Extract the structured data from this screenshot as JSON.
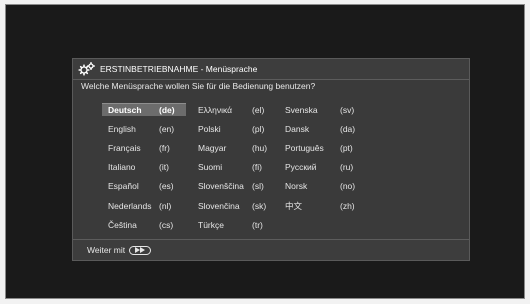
{
  "dialog": {
    "title": "ERSTINBETRIEBNAHME - Menüsprache",
    "icon": "gears-icon",
    "question": "Welche Menüsprache wollen Sie für die Bedienung benutzen?",
    "footer_label": "Weiter mit",
    "footer_icon": "fast-forward-button-icon"
  },
  "languages": [
    {
      "name": "Deutsch",
      "code": "(de)",
      "selected": true
    },
    {
      "name": "English",
      "code": "(en)"
    },
    {
      "name": "Français",
      "code": "(fr)"
    },
    {
      "name": "Italiano",
      "code": "(it)"
    },
    {
      "name": "Español",
      "code": "(es)"
    },
    {
      "name": "Nederlands",
      "code": "(nl)"
    },
    {
      "name": "Čeština",
      "code": "(cs)"
    },
    {
      "name": "Ελληνικά",
      "code": "(el)"
    },
    {
      "name": "Polski",
      "code": "(pl)"
    },
    {
      "name": "Magyar",
      "code": "(hu)"
    },
    {
      "name": "Suomi",
      "code": "(fi)"
    },
    {
      "name": "Slovenščina",
      "code": "(sl)"
    },
    {
      "name": "Slovenčina",
      "code": "(sk)"
    },
    {
      "name": "Türkçe",
      "code": "(tr)"
    },
    {
      "name": "Svenska",
      "code": "(sv)"
    },
    {
      "name": "Dansk",
      "code": "(da)"
    },
    {
      "name": "Português",
      "code": "(pt)"
    },
    {
      "name": "Русский",
      "code": "(ru)"
    },
    {
      "name": "Norsk",
      "code": "(no)"
    },
    {
      "name": "中文",
      "code": "(zh)"
    }
  ]
}
